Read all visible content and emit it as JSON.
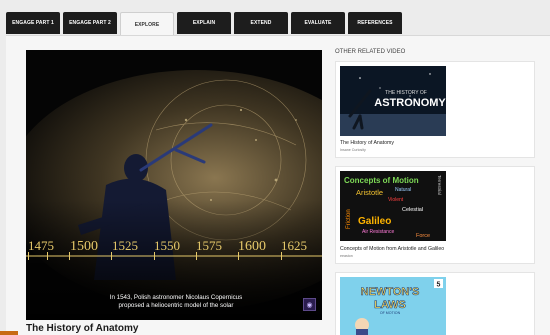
{
  "tabs": [
    {
      "label": "ENGAGE PART 1"
    },
    {
      "label": "ENGAGE PART 2"
    },
    {
      "label": "EXPLORE"
    },
    {
      "label": "EXPLAIN"
    },
    {
      "label": "EXTEND"
    },
    {
      "label": "EVALUATE"
    },
    {
      "label": "REFERENCES"
    }
  ],
  "active_tab": "EXPLORE",
  "video": {
    "timeline_years": [
      "1475",
      "1500",
      "1525",
      "1550",
      "1575",
      "1600",
      "1625"
    ],
    "caption_line1": "In 1543, Polish astronomer Nicolaus Copernicus",
    "caption_line2": "proposed a heliocentric model of the solar",
    "title": "The History of Anatomy"
  },
  "related": {
    "heading": "OTHER RELATED VIDEO",
    "items": [
      {
        "thumb_line1": "THE HISTORY OF",
        "thumb_line2": "ASTRONOMY",
        "title": "The History of Anatomy",
        "meta": "Insane Curiosity"
      },
      {
        "thumb_words": [
          "Concepts of Motion",
          "Aristotle",
          "Natural",
          "Violent",
          "Celestial",
          "Galileo",
          "Air Resistance",
          "Force",
          "Friction",
          "Terrestrial"
        ],
        "title": "Concepts of Motion from Aristotle and Galileo",
        "meta": "eeaston"
      },
      {
        "thumb_line1": "NEWTON'S",
        "thumb_line2": "LAWS",
        "thumb_line3": "OF MOTION",
        "badge": "5"
      }
    ]
  },
  "colors": {
    "tab_bg": "#1d1d1d",
    "panel_bg": "#f6f6f6",
    "timeline_gold": "#e6c96a"
  }
}
